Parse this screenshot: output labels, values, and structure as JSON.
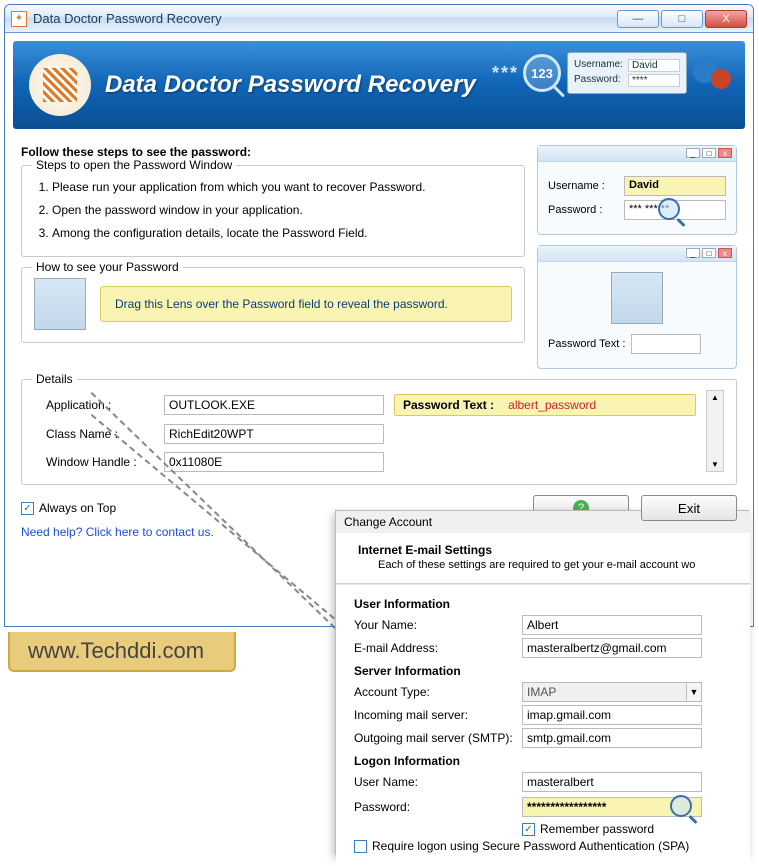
{
  "window": {
    "title": "Data Doctor Password Recovery",
    "minimize": "—",
    "maximize": "□",
    "close": "X"
  },
  "banner": {
    "title": "Data Doctor Password Recovery",
    "stars": "***",
    "magnify_text": "123",
    "mini_login": {
      "username_label": "Username:",
      "username_value": "David",
      "password_label": "Password:",
      "password_value": "****"
    }
  },
  "content": {
    "heading": "Follow these steps to see the password:",
    "steps_group_title": "Steps to open the Password Window",
    "steps": [
      "Please run your application from which you want to recover Password.",
      "Open the password window in your application.",
      "Among the configuration details, locate the Password Field."
    ],
    "how_title": "How to see your Password",
    "hint_text": "Drag this Lens over the Password field to reveal the password.",
    "details_title": "Details",
    "details": {
      "application_label": "Application :",
      "application_value": "OUTLOOK.EXE",
      "classname_label": "Class Name :",
      "classname_value": "RichEdit20WPT",
      "handle_label": "Window Handle :",
      "handle_value": "0x11080E",
      "ptext_label": "Password Text :",
      "ptext_value": "albert_password"
    },
    "always_on_top": "Always on Top",
    "help_link": "Need help? Click here to contact us.",
    "help_btn": "Help",
    "exit_btn": "Exit"
  },
  "preview1": {
    "username_label": "Username :",
    "username_value": "David",
    "password_label": "Password :",
    "password_value": "*** *** **"
  },
  "preview2": {
    "ptext_label": "Password Text :",
    "ptext_value": ""
  },
  "watermark": "www.Techddi.com",
  "outlook": {
    "caption": "Change Account",
    "subtitle": "Internet E-mail Settings",
    "desc": "Each of these settings are required to get your e-mail account wo",
    "user_info": "User Information",
    "your_name_label": "Your Name:",
    "your_name": "Albert",
    "email_label": "E-mail Address:",
    "email": "masteralbertz@gmail.com",
    "server_info": "Server Information",
    "account_type_label": "Account Type:",
    "account_type": "IMAP",
    "incoming_label": "Incoming mail server:",
    "incoming": "imap.gmail.com",
    "outgoing_label": "Outgoing mail server (SMTP):",
    "outgoing": "smtp.gmail.com",
    "logon_info": "Logon Information",
    "username_label": "User Name:",
    "username": "masteralbert",
    "password_label": "Password:",
    "password": "*****************",
    "remember": "Remember password",
    "spa": "Require logon using Secure Password Authentication (SPA)"
  }
}
